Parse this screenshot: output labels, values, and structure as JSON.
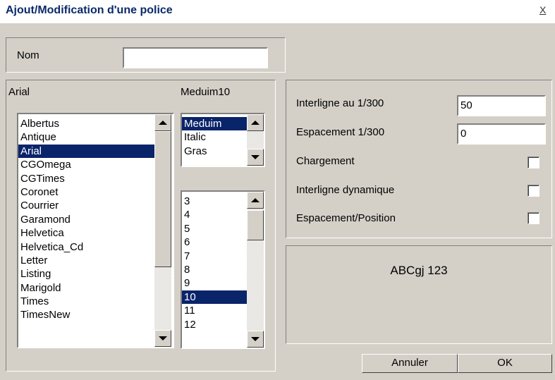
{
  "window": {
    "title": "Ajout/Modification d'une police",
    "close_glyph": "X"
  },
  "name_field": {
    "label": "Nom",
    "value": ""
  },
  "font": {
    "selected_label": "Arial",
    "items": [
      "Albertus",
      "Antique",
      "Arial",
      "CGOmega",
      "CGTimes",
      "Coronet",
      "Courrier",
      "Garamond",
      "Helvetica",
      "Helvetica_Cd",
      "Letter",
      "Listing",
      "Marigold",
      "Times",
      "TimesNew"
    ],
    "selected": "Arial"
  },
  "style": {
    "selected_label": "Meduim10",
    "items": [
      "Meduim",
      "Italic",
      "Gras"
    ],
    "selected": "Meduim"
  },
  "size": {
    "items": [
      "3",
      "4",
      "5",
      "6",
      "7",
      "8",
      "9",
      "10",
      "11",
      "12"
    ],
    "selected": "10"
  },
  "options": {
    "interligne_label": "Interligne au 1/300",
    "interligne_value": "50",
    "espacement_label": "Espacement 1/300",
    "espacement_value": "0",
    "chargement_label": "Chargement",
    "chargement_checked": false,
    "interligne_dyn_label": "Interligne dynamique",
    "interligne_dyn_checked": false,
    "espacement_pos_label": "Espacement/Position",
    "espacement_pos_checked": false
  },
  "preview": {
    "text": "ABCgj 123"
  },
  "buttons": {
    "cancel": "Annuler",
    "ok": "OK"
  }
}
